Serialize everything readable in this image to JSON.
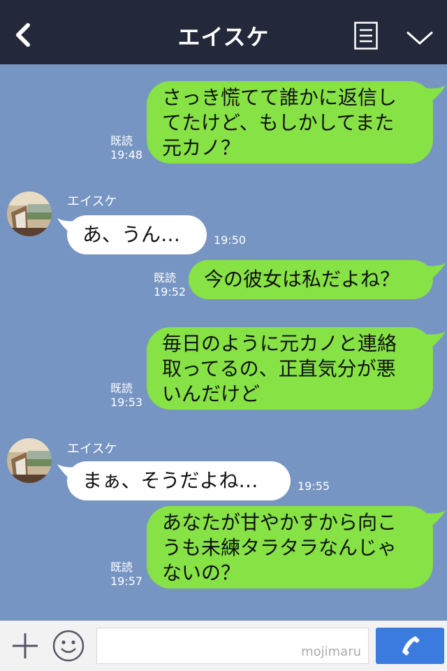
{
  "header": {
    "title": "エイスケ",
    "back_icon": "chevron-left-icon",
    "menu_icon": "list-icon",
    "collapse_icon": "chevron-down-icon"
  },
  "messages": [
    {
      "side": "me",
      "text": "さっき慌てて誰かに返信し\nてたけど、もしかしてまた\n元カノ？",
      "read": "既読",
      "time": "19:48"
    },
    {
      "side": "them",
      "sender": "エイスケ",
      "text": "あ、うん…",
      "time": "19:50"
    },
    {
      "side": "me",
      "text": "今の彼女は私だよね？",
      "read": "既読",
      "time": "19:52"
    },
    {
      "side": "me",
      "text": "毎日のように元カノと連絡\n取ってるの、正直気分が悪\nいんだけど",
      "read": "既読",
      "time": "19:53"
    },
    {
      "side": "them",
      "sender": "エイスケ",
      "text": "まぁ、そうだよね…",
      "time": "19:55"
    },
    {
      "side": "me",
      "text": "あなたが甘やかすから向こ\nうも未練タラタラなんじゃ\nないの？",
      "read": "既読",
      "time": "19:57"
    }
  ],
  "footer": {
    "watermark": "mojimaru",
    "plus_icon": "plus-icon",
    "emoji_icon": "smiley-icon",
    "call_icon": "phone-icon"
  },
  "colors": {
    "header_bg": "#23283a",
    "chat_bg": "#7795c2",
    "my_bubble": "#86e245",
    "their_bubble": "#ffffff",
    "call_button": "#3b7be0"
  }
}
